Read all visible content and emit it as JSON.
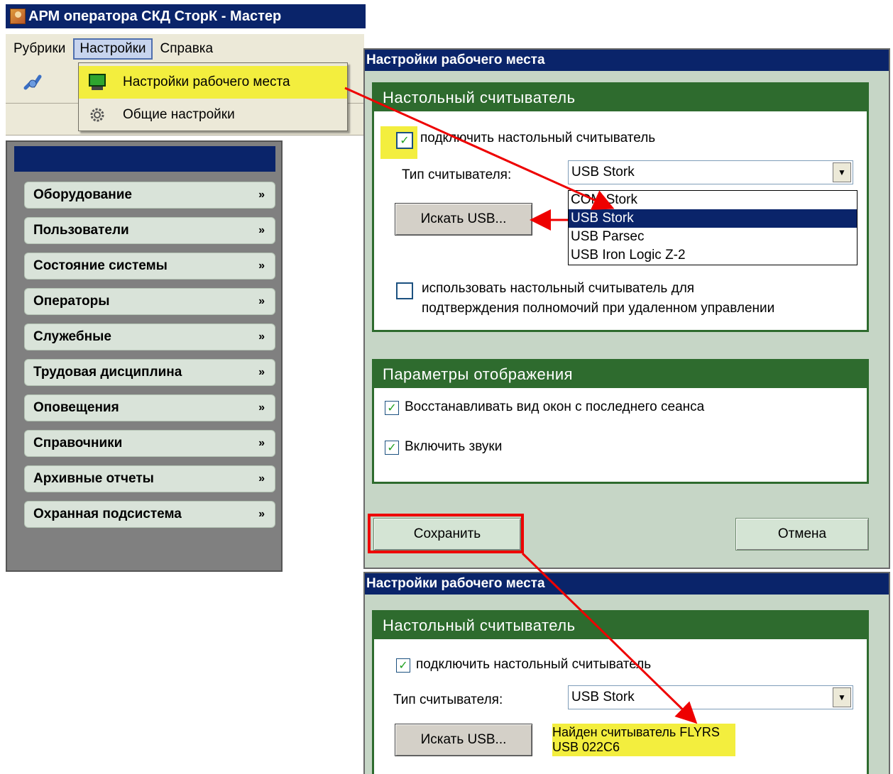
{
  "app": {
    "title": "АРМ оператора СКД СторК - Мастер",
    "menu": [
      "Рубрики",
      "Настройки",
      "Справка"
    ]
  },
  "settings_menu": {
    "items": [
      "Настройки рабочего места",
      "Общие настройки"
    ]
  },
  "nav": {
    "items": [
      "Оборудование",
      "Пользователи",
      "Состояние системы",
      "Операторы",
      "Служебные",
      "Трудовая дисциплина",
      "Оповещения",
      "Справочники",
      "Архивные отчеты",
      "Охранная подсистема"
    ]
  },
  "dialog1": {
    "title": "Настройки рабочего места",
    "reader_group_title": "Настольный считыватель",
    "connect_label": "подключить настольный считыватель",
    "connect_checked": true,
    "reader_type_label": "Тип считывателя:",
    "reader_type_value": "USB Stork",
    "reader_type_options": [
      "COM Stork",
      "USB Stork",
      "USB Parsec",
      "USB Iron Logic Z-2"
    ],
    "search_usb_button": "Искать USB...",
    "use_reader_label_line1": "использовать настольный считыватель для",
    "use_reader_label_line2": "подтверждения полномочий при удаленном управлении",
    "use_reader_checked": false,
    "display_group_title": "Параметры отображения",
    "restore_windows_label": "Восстанавливать вид окон с последнего сеанса",
    "restore_windows_checked": true,
    "sounds_label": "Включить звуки",
    "sounds_checked": true,
    "save_button": "Сохранить",
    "cancel_button": "Отмена"
  },
  "dialog2": {
    "title": "Настройки рабочего места",
    "reader_group_title": "Настольный считыватель",
    "connect_label": "подключить настольный считыватель",
    "connect_checked": true,
    "reader_type_label": "Тип считывателя:",
    "reader_type_value": "USB Stork",
    "search_usb_button": "Искать USB...",
    "found_message": "Найден считыватель FLYRS USB 022C6"
  },
  "icons": {
    "chevron": "double-chevron-down-icon",
    "check": "checkmark-icon"
  },
  "colors": {
    "titlebar": "#0a246a",
    "group_header": "#2e6b2e",
    "highlight": "#f3ee3e",
    "annotation": "#e00000"
  }
}
